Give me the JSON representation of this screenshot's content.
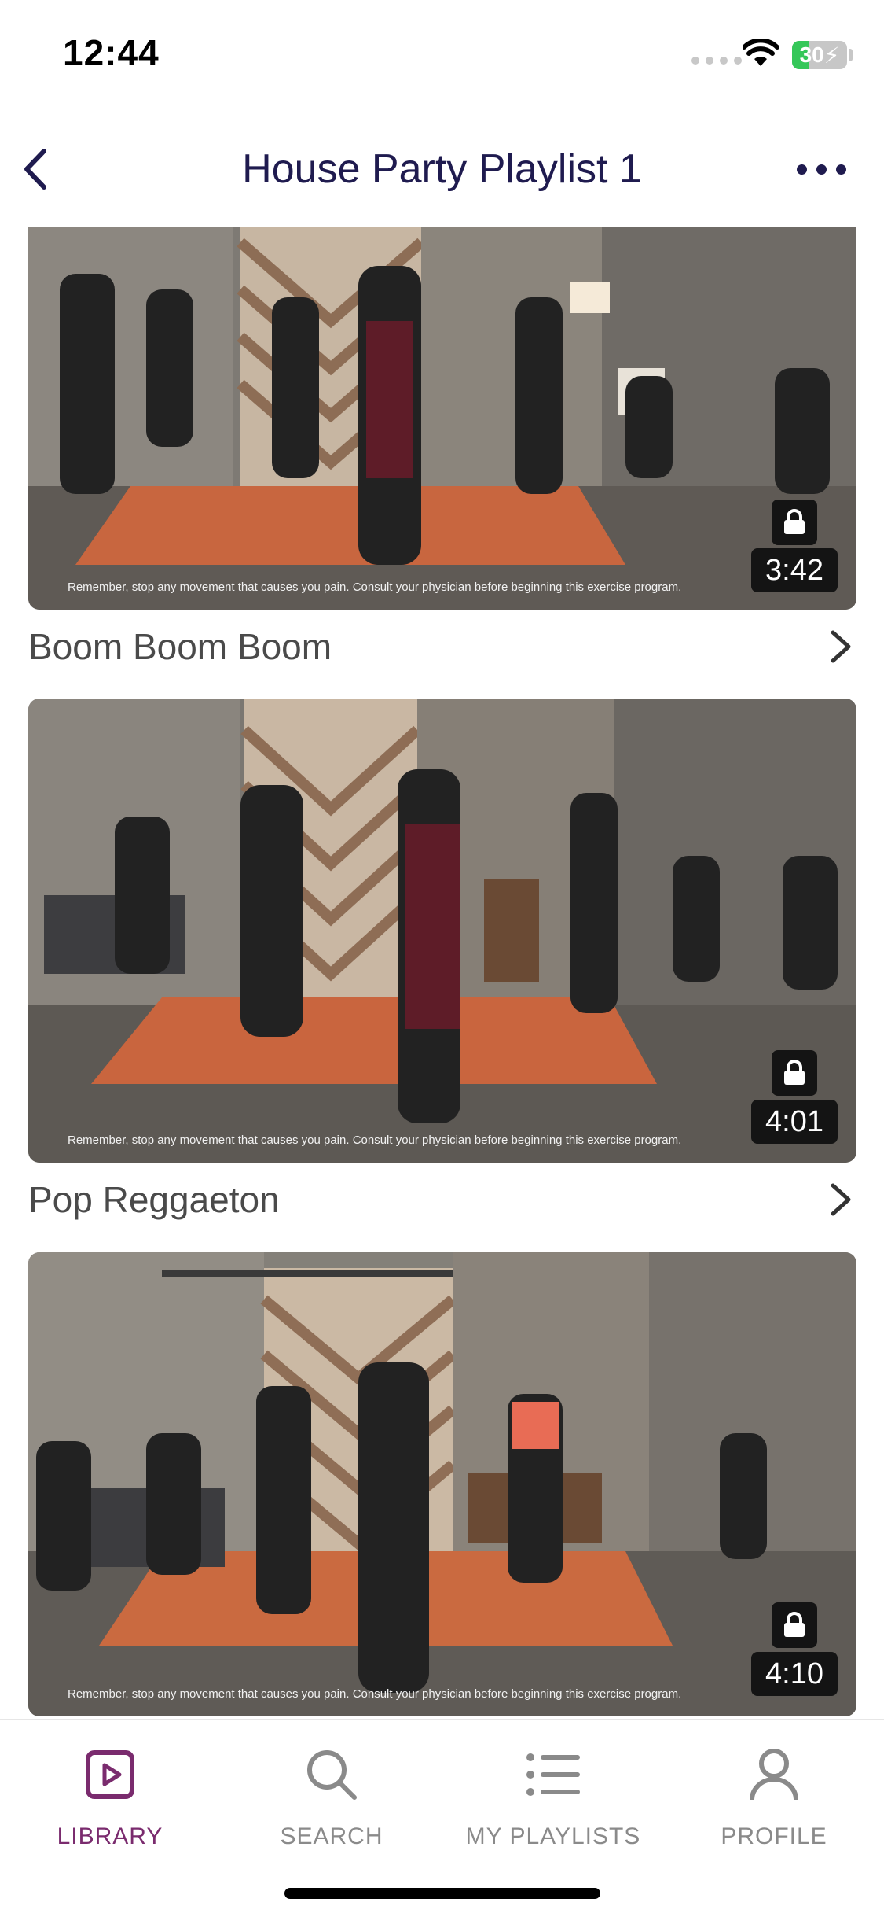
{
  "status_bar": {
    "time": "12:44",
    "battery": "30"
  },
  "header": {
    "title": "House Party Playlist 1"
  },
  "videos": [
    {
      "title": "Boom Boom Boom",
      "duration": "3:42",
      "disclaimer": "Remember, stop any movement that causes you pain. Consult your physician before beginning this exercise program."
    },
    {
      "title": "Pop Reggaeton",
      "duration": "4:01",
      "disclaimer": "Remember, stop any movement that causes you pain. Consult your physician before beginning this exercise program."
    },
    {
      "title": "",
      "duration": "4:10",
      "disclaimer": "Remember, stop any movement that causes you pain. Consult your physician before beginning this exercise program."
    }
  ],
  "tabs": [
    {
      "label": "LIBRARY",
      "icon": "play-square-icon",
      "active": true
    },
    {
      "label": "SEARCH",
      "icon": "search-icon",
      "active": false
    },
    {
      "label": "MY PLAYLISTS",
      "icon": "list-icon",
      "active": false
    },
    {
      "label": "PROFILE",
      "icon": "person-icon",
      "active": false
    }
  ],
  "colors": {
    "accent": "#7a2b6e",
    "title": "#1f1b4f",
    "battery": "#35c759"
  }
}
